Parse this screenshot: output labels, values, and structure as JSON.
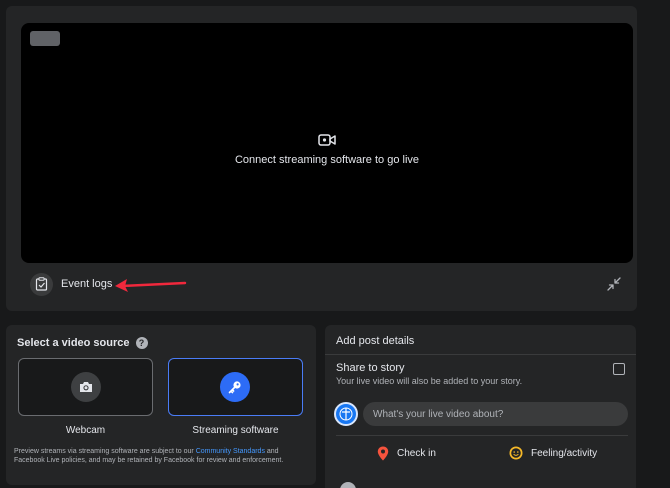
{
  "preview": {
    "message": "Connect streaming software to go live"
  },
  "event_logs": {
    "label": "Event logs"
  },
  "source": {
    "title": "Select a video source",
    "help_symbol": "?",
    "options": [
      {
        "label": "Webcam",
        "icon": "camera-icon",
        "selected": false
      },
      {
        "label": "Streaming software",
        "icon": "key-icon",
        "selected": true
      }
    ],
    "note_prefix": "Preview streams via streaming software are subject to our ",
    "note_link": "Community Standards",
    "note_suffix": " and Facebook Live policies, and may be retained by Facebook for review and enforcement."
  },
  "post": {
    "title": "Add post details",
    "share_title": "Share to story",
    "share_sub": "Your live video will also be added to your story.",
    "description_placeholder": "What's your live video about?",
    "check_in": "Check in",
    "feeling": "Feeling/activity"
  },
  "colors": {
    "accent": "#2d6cf6",
    "selected_border": "#4a7cf6",
    "arrow": "#f0283c",
    "link": "#4599ff"
  }
}
